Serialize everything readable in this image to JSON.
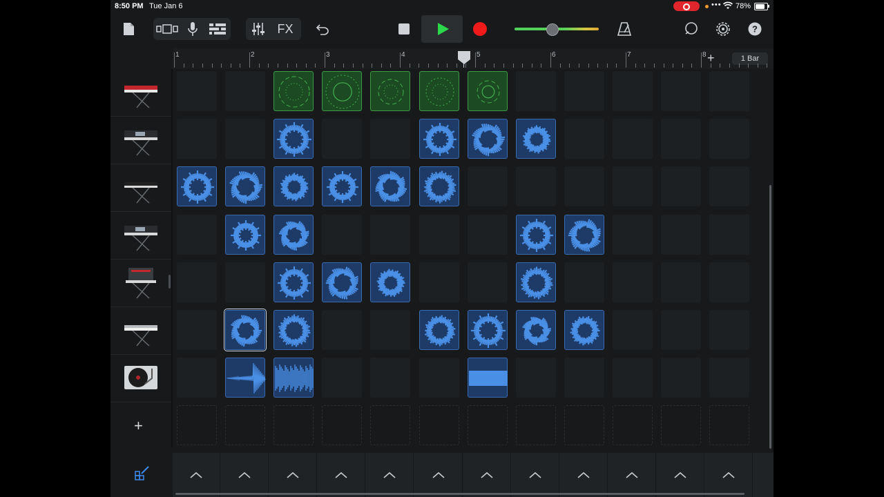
{
  "status_bar": {
    "time": "8:50 PM",
    "date": "Tue Jan 6",
    "battery": "78%"
  },
  "toolbar": {
    "fx_label": "FX",
    "accent_play": "#2bd94a",
    "accent_record": "#f01a1a",
    "volume_level": 0.45
  },
  "ruler": {
    "bars": [
      "1",
      "2",
      "3",
      "4",
      "5",
      "6",
      "7",
      "8"
    ],
    "bar_length_label": "1 Bar",
    "add_label": "+"
  },
  "tracks": [
    {
      "name": "red-synth-keyboard"
    },
    {
      "name": "black-synth-workstation"
    },
    {
      "name": "digital-piano"
    },
    {
      "name": "black-synth-workstation"
    },
    {
      "name": "modular-synth"
    },
    {
      "name": "silver-keyboard"
    },
    {
      "name": "turntable"
    }
  ],
  "add_track_label": "+",
  "grid": {
    "columns": 12,
    "cells": [
      {
        "row": 0,
        "col": 2,
        "kind": "drum"
      },
      {
        "row": 0,
        "col": 3,
        "kind": "drum"
      },
      {
        "row": 0,
        "col": 4,
        "kind": "drum"
      },
      {
        "row": 0,
        "col": 5,
        "kind": "drum"
      },
      {
        "row": 0,
        "col": 6,
        "kind": "drum"
      },
      {
        "row": 1,
        "col": 2,
        "kind": "loop"
      },
      {
        "row": 1,
        "col": 5,
        "kind": "loop"
      },
      {
        "row": 1,
        "col": 6,
        "kind": "loop"
      },
      {
        "row": 1,
        "col": 7,
        "kind": "loop"
      },
      {
        "row": 2,
        "col": 0,
        "kind": "loop"
      },
      {
        "row": 2,
        "col": 1,
        "kind": "loop"
      },
      {
        "row": 2,
        "col": 2,
        "kind": "loop"
      },
      {
        "row": 2,
        "col": 3,
        "kind": "loop"
      },
      {
        "row": 2,
        "col": 4,
        "kind": "loop"
      },
      {
        "row": 2,
        "col": 5,
        "kind": "loop"
      },
      {
        "row": 3,
        "col": 1,
        "kind": "loop"
      },
      {
        "row": 3,
        "col": 2,
        "kind": "loop"
      },
      {
        "row": 3,
        "col": 7,
        "kind": "loop"
      },
      {
        "row": 3,
        "col": 8,
        "kind": "loop"
      },
      {
        "row": 4,
        "col": 2,
        "kind": "loop"
      },
      {
        "row": 4,
        "col": 3,
        "kind": "loop"
      },
      {
        "row": 4,
        "col": 4,
        "kind": "loop"
      },
      {
        "row": 4,
        "col": 7,
        "kind": "loop"
      },
      {
        "row": 5,
        "col": 1,
        "kind": "loop",
        "selected": true
      },
      {
        "row": 5,
        "col": 2,
        "kind": "loop"
      },
      {
        "row": 5,
        "col": 5,
        "kind": "loop"
      },
      {
        "row": 5,
        "col": 6,
        "kind": "loop"
      },
      {
        "row": 5,
        "col": 7,
        "kind": "loop"
      },
      {
        "row": 5,
        "col": 8,
        "kind": "loop"
      },
      {
        "row": 6,
        "col": 1,
        "kind": "wave-hit"
      },
      {
        "row": 6,
        "col": 2,
        "kind": "wave-dense"
      },
      {
        "row": 6,
        "col": 6,
        "kind": "wave-block"
      }
    ]
  },
  "trigger_count": 12,
  "colors": {
    "clip_blue": "#4a8fe6",
    "clip_green": "#43b04d",
    "background": "#17191b"
  }
}
